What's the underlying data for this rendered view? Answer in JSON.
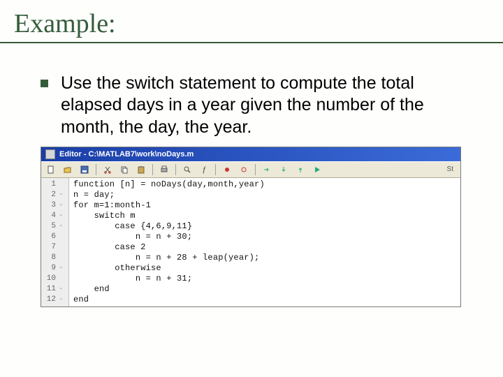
{
  "title": "Example:",
  "bullet_text": "Use the switch statement to compute the total elapsed days in a year given the number of the month, the day, the year.",
  "editor": {
    "title": "Editor - C:\\MATLAB7\\work\\noDays.m",
    "stack_label": "St",
    "gutter": [
      {
        "n": "1",
        "dash": ""
      },
      {
        "n": "2",
        "dash": "-"
      },
      {
        "n": "3",
        "dash": "-"
      },
      {
        "n": "4",
        "dash": "-"
      },
      {
        "n": "5",
        "dash": "-"
      },
      {
        "n": "6",
        "dash": ""
      },
      {
        "n": "7",
        "dash": ""
      },
      {
        "n": "8",
        "dash": ""
      },
      {
        "n": "9",
        "dash": "-"
      },
      {
        "n": "10",
        "dash": ""
      },
      {
        "n": "11",
        "dash": "-"
      },
      {
        "n": "12",
        "dash": "-"
      }
    ],
    "code": [
      "function [n] = noDays(day,month,year)",
      "n = day;",
      "for m=1:month-1",
      "    switch m",
      "        case {4,6,9,11}",
      "            n = n + 30;",
      "        case 2",
      "            n = n + 28 + leap(year);",
      "        otherwise",
      "            n = n + 31;",
      "    end",
      "end"
    ]
  }
}
